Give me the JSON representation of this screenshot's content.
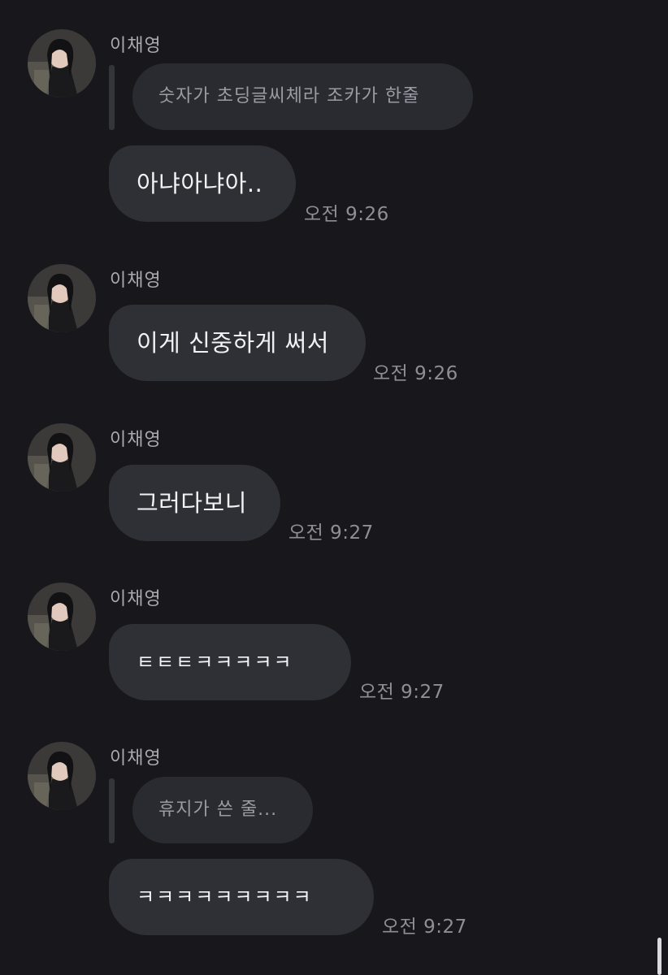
{
  "messages": [
    {
      "sender": "이채영",
      "reply_quote": "숫자가 초딩글씨체라 조카가 한줄",
      "text": "아냐아냐아..",
      "time": "오전 9:26"
    },
    {
      "sender": "이채영",
      "text": "이게 신중하게 써서",
      "time": "오전 9:26"
    },
    {
      "sender": "이채영",
      "text": "그러다보니",
      "time": "오전 9:27"
    },
    {
      "sender": "이채영",
      "text": "ㅌㅌㅌㅋㅋㅋㅋㅋ",
      "time": "오전 9:27"
    },
    {
      "sender": "이채영",
      "reply_quote": "휴지가 쓴 줄...",
      "text": "ㅋㅋㅋㅋㅋㅋㅋㅋㅋ",
      "time": "오전 9:27"
    }
  ],
  "colors": {
    "background": "#18181c",
    "bubble": "#2f3036",
    "reply_bubble": "#2a2b30",
    "text": "#f2f2f4",
    "secondary_text": "#8e8e96"
  },
  "icons": {
    "avatar": "profile-photo"
  }
}
